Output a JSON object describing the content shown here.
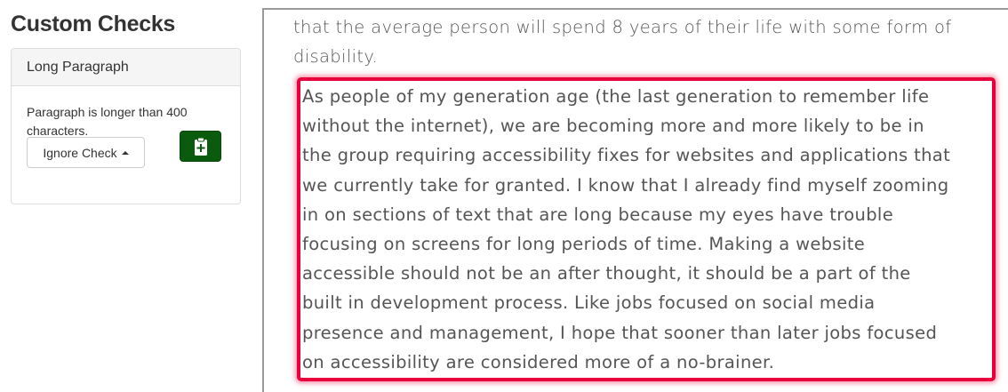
{
  "sidebar": {
    "title": "Custom Checks"
  },
  "check_panel": {
    "heading": "Long Paragraph",
    "message": "Paragraph is longer than 400 characters.",
    "ignore_button_label": "Ignore Check",
    "ignore_button_icon": "caret-up-icon",
    "clipboard_button_icon": "clipboard-plus-icon",
    "clipboard_button_color": "#0b5b0f"
  },
  "content": {
    "previous_text_lines": [
      "that the average person will spend 8 years of their life with some form of",
      "disability."
    ],
    "highlight_color": "#e8003c",
    "highlighted_paragraph_lines": [
      "As people of my generation age (the last generation to remember life",
      "without the internet), we are becoming more and more likely to be in",
      "the group requiring accessibility fixes for websites and applications that",
      "we currently take for granted. I know that I already find myself zooming",
      "in on sections of text that are long because my eyes have trouble",
      "focusing on screens for long periods of time. Making a website",
      "accessible should not be an after thought, it should be a part of the",
      "built in development process. Like jobs focused on social media",
      "presence and management, I hope that sooner than later jobs focused",
      "on accessibility are considered more of a no-brainer."
    ]
  }
}
